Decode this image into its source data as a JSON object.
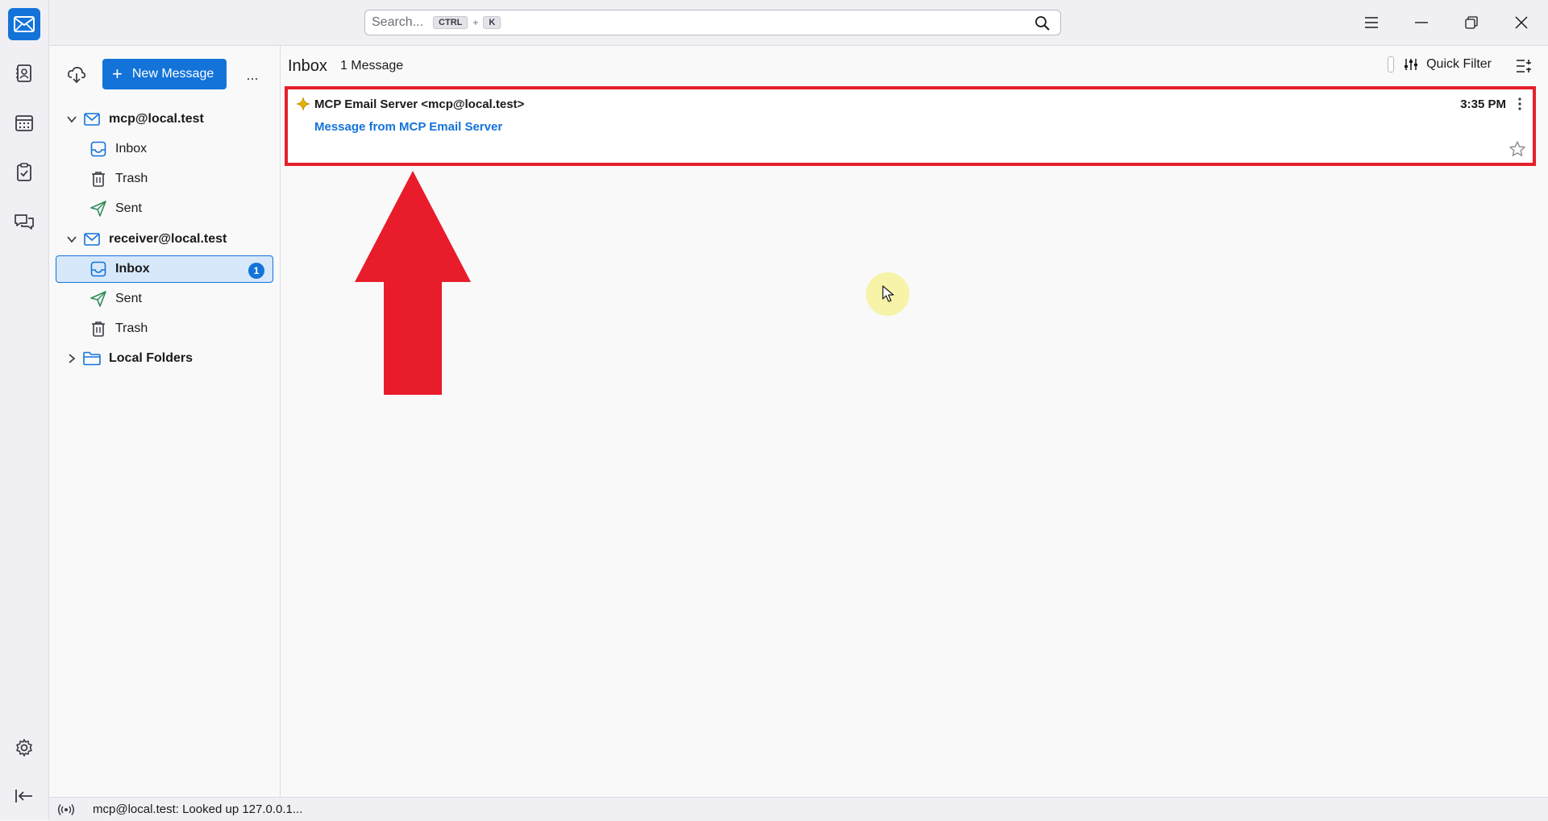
{
  "search": {
    "placeholder": "Search...",
    "key1": "CTRL",
    "plus": "+",
    "key2": "K"
  },
  "folder_pane": {
    "new_message": "New Message",
    "more": "...",
    "accounts": [
      {
        "name": "mcp@local.test",
        "folders": [
          "Inbox",
          "Trash",
          "Sent"
        ]
      },
      {
        "name": "receiver@local.test",
        "folders": [
          "Inbox",
          "Sent",
          "Trash"
        ],
        "unread": "1"
      },
      {
        "name": "Local Folders"
      }
    ]
  },
  "list": {
    "folder_title": "Inbox",
    "count": "1 Message",
    "quick_filter": "Quick Filter"
  },
  "message": {
    "sender": "MCP Email Server <mcp@local.test>",
    "subject": "Message from MCP Email Server",
    "time": "3:35 PM"
  },
  "status": {
    "text": "mcp@local.test: Looked up 127.0.0.1..."
  },
  "colors": {
    "accent": "#1373d9",
    "highlight": "#e5202a"
  }
}
